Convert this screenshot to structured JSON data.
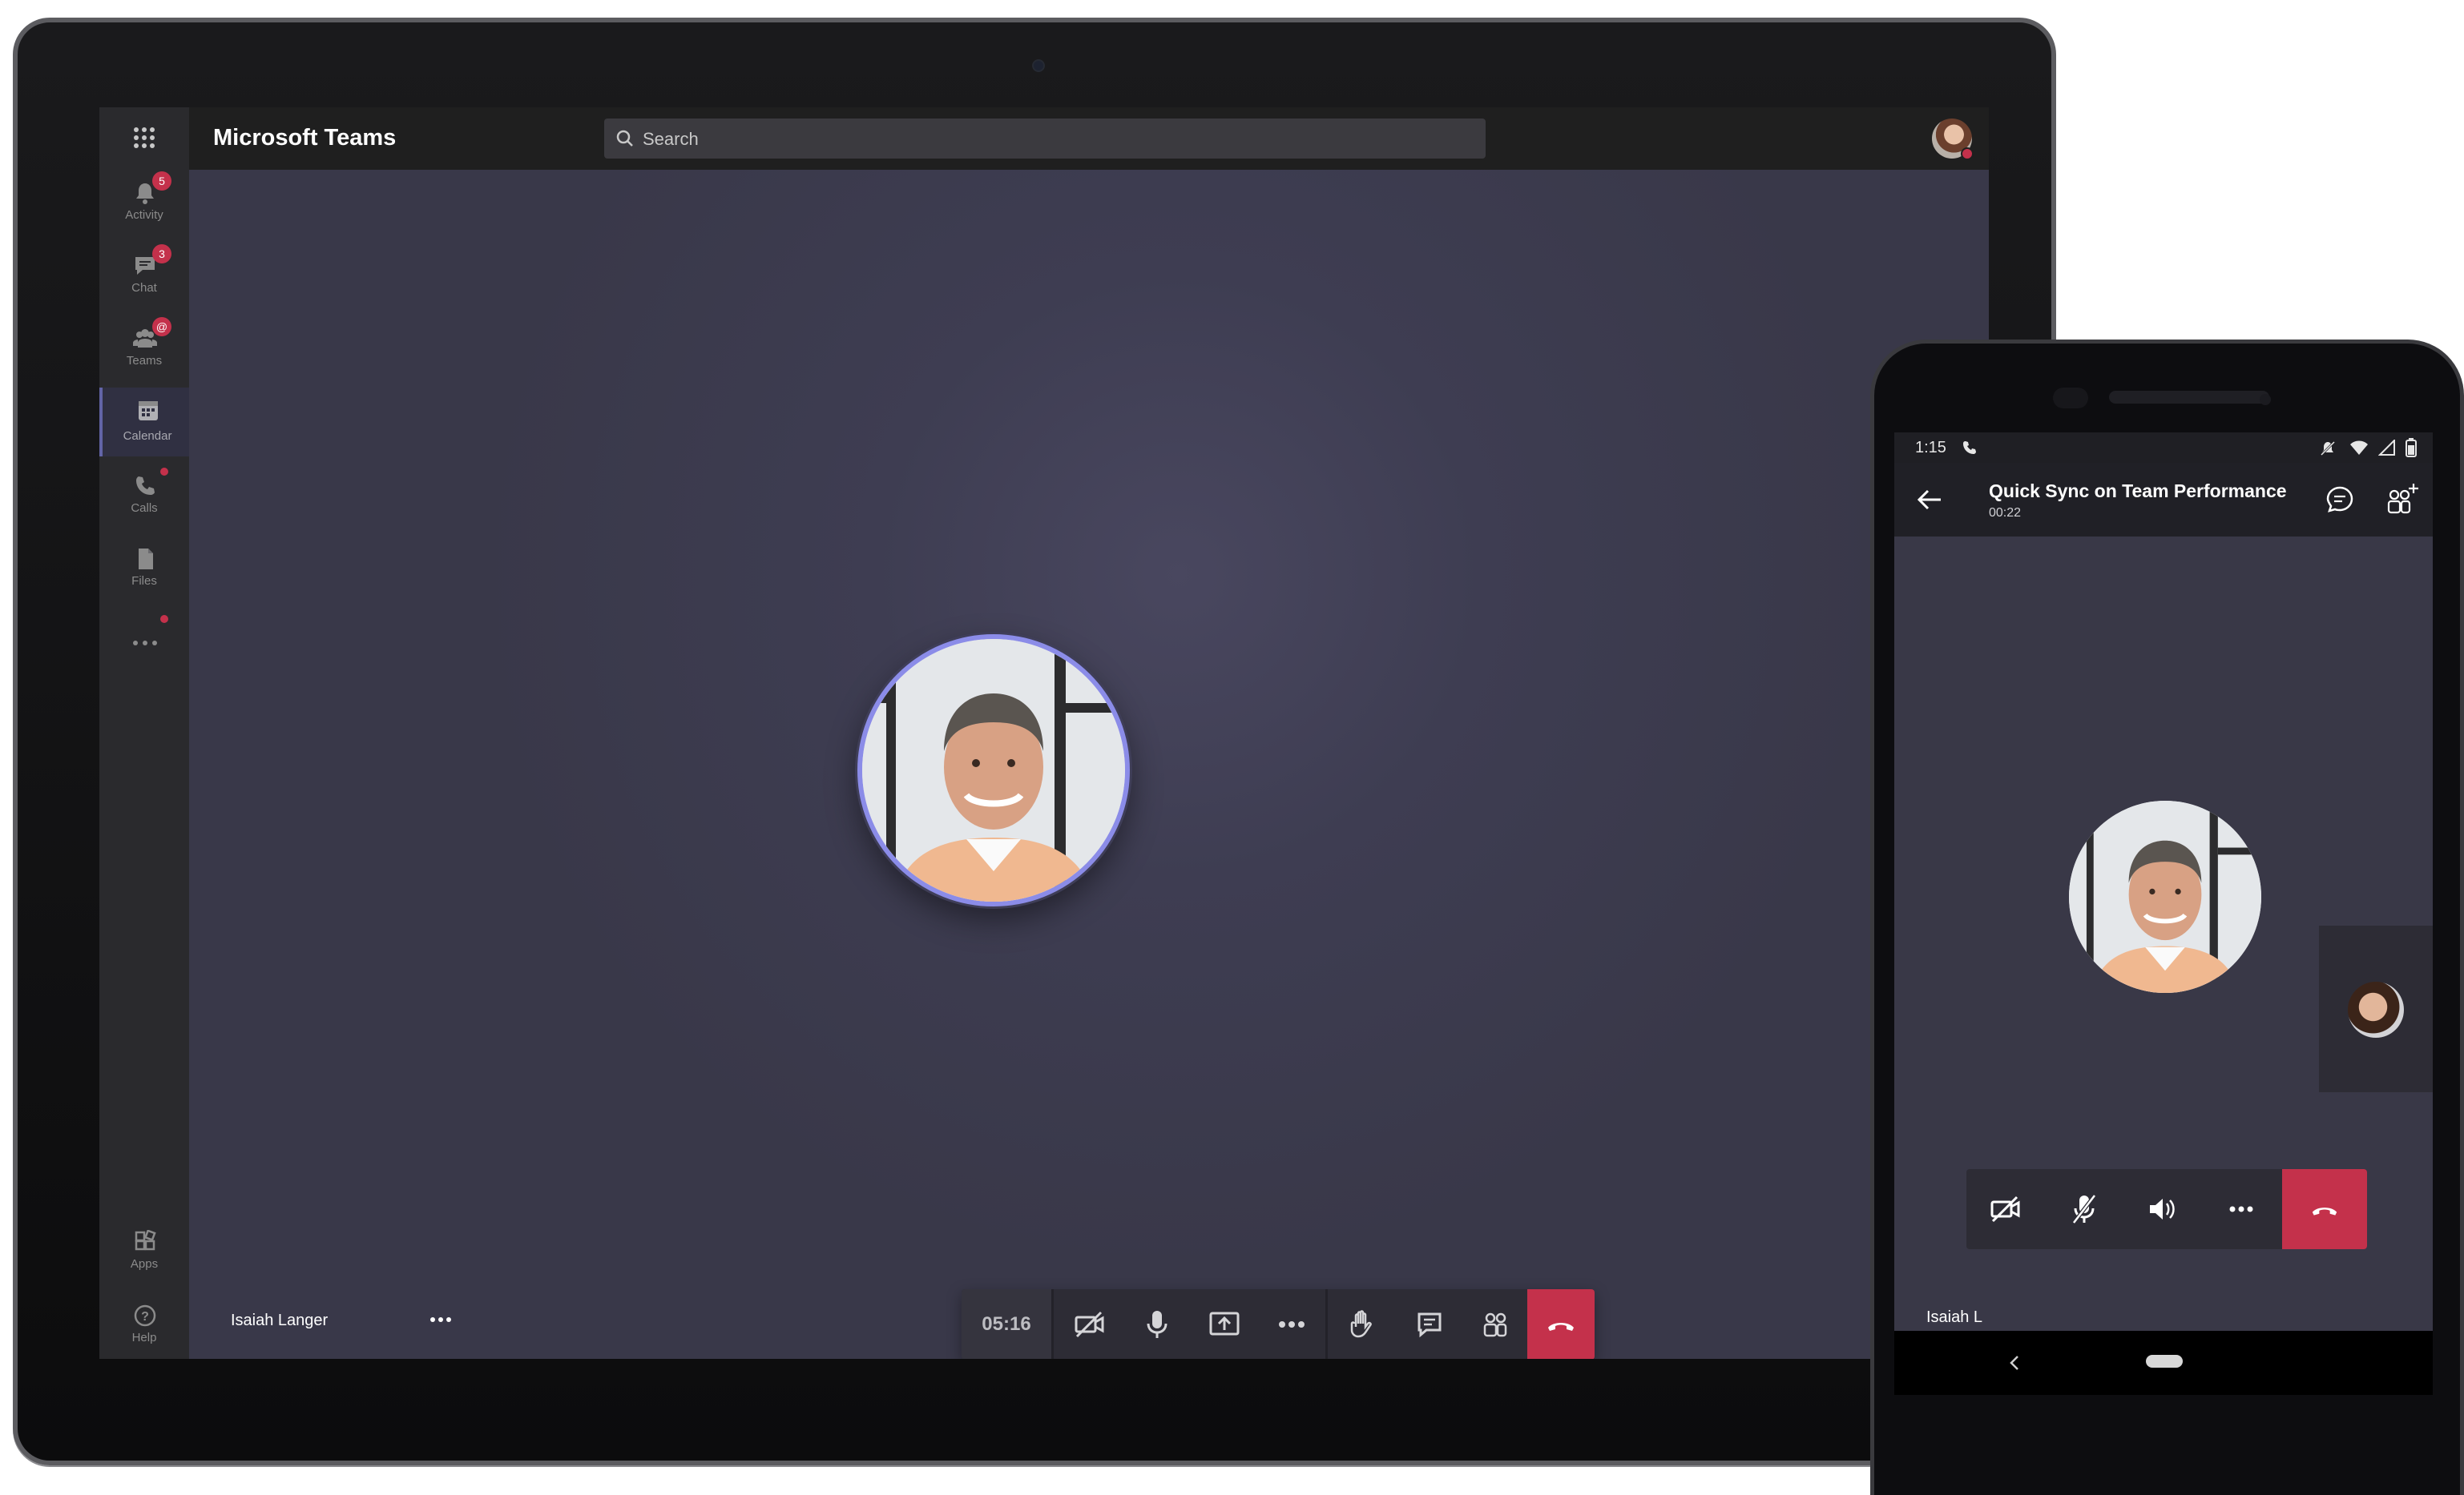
{
  "tablet": {
    "app_title": "Microsoft Teams",
    "search": {
      "placeholder": "Search"
    },
    "rail": [
      {
        "label": "Activity",
        "icon": "bell-icon",
        "badge": "5"
      },
      {
        "label": "Chat",
        "icon": "chat-icon",
        "badge": "3"
      },
      {
        "label": "Teams",
        "icon": "teams-icon",
        "badge": "@"
      },
      {
        "label": "Calendar",
        "icon": "calendar-icon",
        "active": true
      },
      {
        "label": "Calls",
        "icon": "phone-icon"
      },
      {
        "label": "Files",
        "icon": "file-icon"
      },
      {
        "label": "Apps",
        "icon": "apps-icon"
      },
      {
        "label": "Help",
        "icon": "help-icon"
      }
    ],
    "call": {
      "timer": "05:16",
      "participant_name": "Isaiah Langer"
    }
  },
  "phone": {
    "status_time": "1:15",
    "meeting_title": "Quick Sync on Team Performance",
    "meeting_duration": "00:22",
    "participant_name": "Isaiah L"
  },
  "colors": {
    "accent": "#6264a7",
    "hangup": "#c4314b",
    "stage": "#393849",
    "titlebar": "#1f1f1f"
  }
}
